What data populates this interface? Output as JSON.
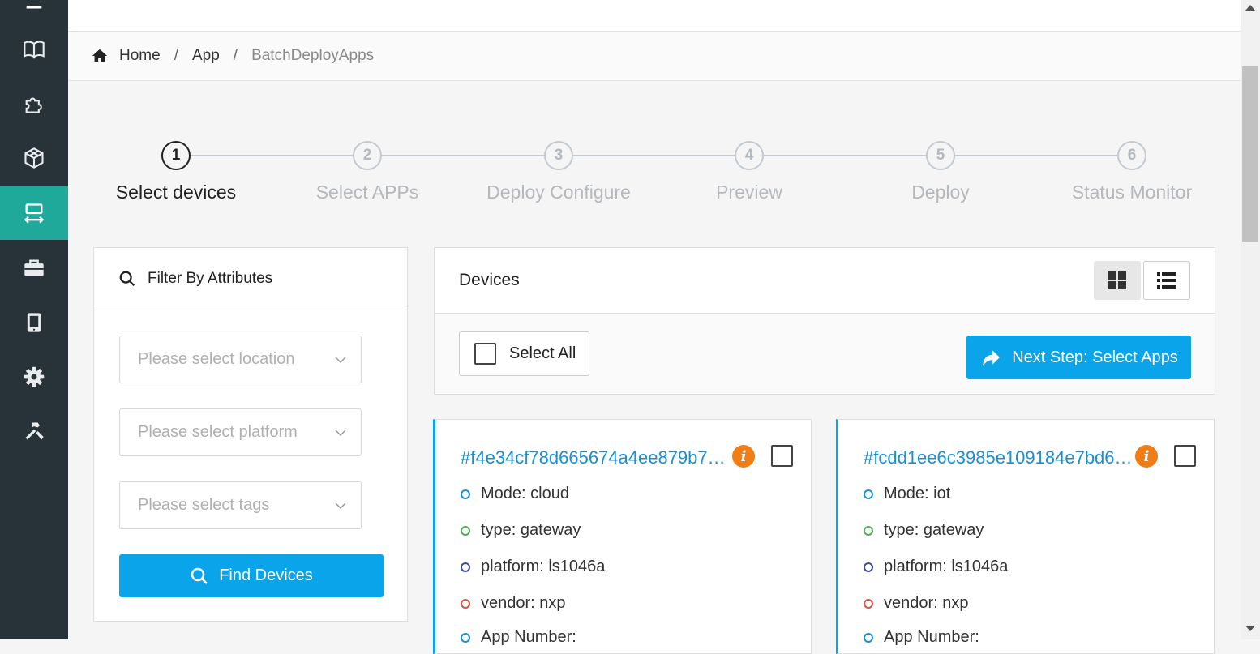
{
  "colors": {
    "sidebar": "#283339",
    "accent": "#1fa99a",
    "primary": "#0aa4ea",
    "link": "#1890d6",
    "info": "#f07d16"
  },
  "sidebar": {
    "items": [
      {
        "icon": "menu-icon"
      },
      {
        "icon": "book-icon"
      },
      {
        "icon": "puzzle-icon"
      },
      {
        "icon": "cube-icon"
      },
      {
        "icon": "deploy-icon",
        "active": true
      },
      {
        "icon": "briefcase-icon"
      },
      {
        "icon": "tablet-icon"
      },
      {
        "icon": "gear-icon"
      },
      {
        "icon": "tools-icon"
      }
    ]
  },
  "breadcrumb": {
    "home": "Home",
    "app": "App",
    "current": "BatchDeployApps",
    "separator": "/"
  },
  "steps": [
    {
      "number": "1",
      "label": "Select devices",
      "active": true
    },
    {
      "number": "2",
      "label": "Select APPs"
    },
    {
      "number": "3",
      "label": "Deploy Configure"
    },
    {
      "number": "4",
      "label": "Preview"
    },
    {
      "number": "5",
      "label": "Deploy"
    },
    {
      "number": "6",
      "label": "Status Monitor"
    }
  ],
  "filter": {
    "title": "Filter By Attributes",
    "location_placeholder": "Please select location",
    "platform_placeholder": "Please select platform",
    "tags_placeholder": "Please select tags",
    "find_label": "Find Devices"
  },
  "devices": {
    "title": "Devices",
    "select_all_label": "Select All",
    "next_label": "Next Step: Select Apps",
    "cards": [
      {
        "id": "#f4e34cf78d665674a4ee879b70…",
        "mode": "Mode: cloud",
        "type": "type: gateway",
        "platform": "platform: ls1046a",
        "vendor": "vendor: nxp",
        "app_number": "App Number:"
      },
      {
        "id": "#fcdd1ee6c3985e109184e7bd6…",
        "mode": "Mode: iot",
        "type": "type: gateway",
        "platform": "platform: ls1046a",
        "vendor": "vendor: nxp",
        "app_number": "App Number:"
      }
    ]
  }
}
